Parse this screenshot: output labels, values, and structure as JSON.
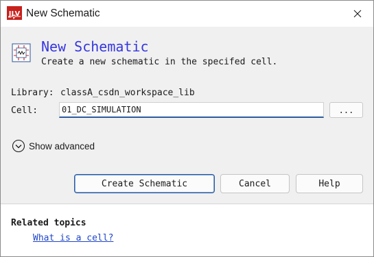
{
  "window": {
    "title": "New Schematic",
    "app_icon": "jlv-app-icon",
    "close_icon": "close-icon"
  },
  "header": {
    "icon": "schematic-icon",
    "title": "New Schematic",
    "subtitle": "Create a new schematic in the specifed cell."
  },
  "form": {
    "library_label": "Library:",
    "library_value": "classA_csdn_workspace_lib",
    "cell_label": "Cell:",
    "cell_value": "01_DC_SIMULATION",
    "browse_label": "..."
  },
  "advanced": {
    "icon": "chevron-down-circle-icon",
    "label": "Show advanced"
  },
  "buttons": {
    "create": "Create Schematic",
    "cancel": "Cancel",
    "help": "Help"
  },
  "related": {
    "title": "Related topics",
    "link": "What is a cell?"
  },
  "colors": {
    "title_accent": "#3636e0",
    "link": "#2046c8",
    "focus_border": "#2c5a9c",
    "app_icon_red": "#c8201c"
  }
}
